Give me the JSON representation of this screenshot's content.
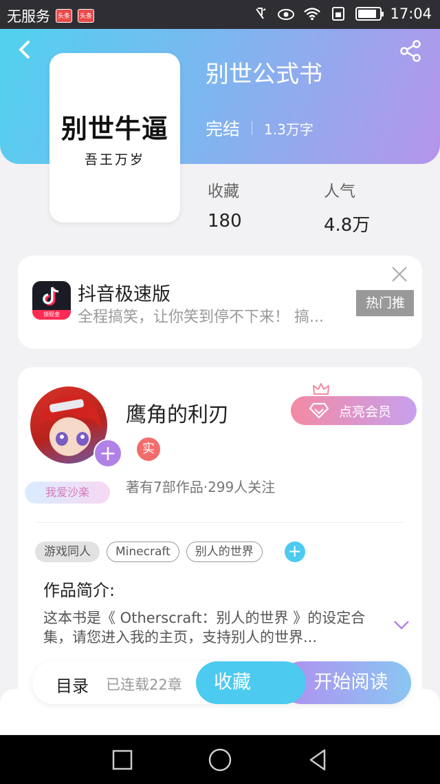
{
  "status_bar": {
    "carrier": "无服务",
    "badge_1": "头条",
    "badge_2": "头条",
    "time": "17:04",
    "battery_level": 0.85
  },
  "book": {
    "title": "别世公式书",
    "status": "完结",
    "word_count": "1.3万字",
    "cover_title": "别世牛逼",
    "cover_subtitle": "吾王万岁",
    "favorites_label": "收藏",
    "favorites_value": "180",
    "popularity_label": "人气",
    "popularity_value": "4.8万"
  },
  "ad": {
    "app_name": "抖音极速版",
    "description": "全程搞笑，让你笑到停不下来！ 搞...",
    "tag": "热门推",
    "icon_tag": "领现金"
  },
  "author": {
    "name": "鹰角的利刃",
    "verified_label": "实",
    "stats": "著有7部作品·299人关注",
    "badge": "我爱沙楽",
    "vip_button": "点亮会员"
  },
  "tags": [
    "游戏同人",
    "Minecraft",
    "别人的世界"
  ],
  "intro": {
    "heading": "作品简介:",
    "text": "这本书是《 Otherscraft：别人的世界 》的设定合集，请您进入我的主页，支持别人的世界..."
  },
  "action_bar": {
    "toc_label": "目录",
    "chapter_count": "已连载22章",
    "favorite_button": "收藏",
    "read_button": "开始阅读"
  },
  "colors": {
    "header_start": "#4fd3ef",
    "header_end": "#b595ea",
    "accent_blue": "#4ccaf0",
    "accent_purple": "#b081e6"
  }
}
